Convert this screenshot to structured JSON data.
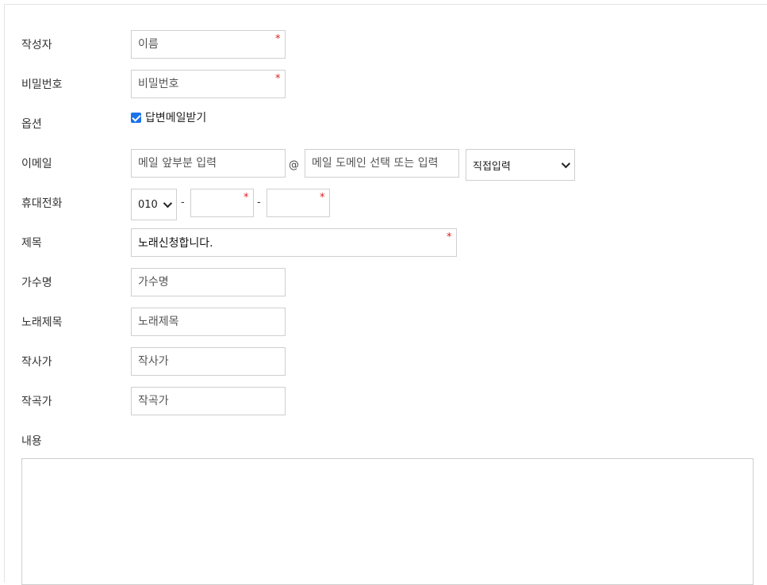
{
  "form": {
    "author": {
      "label": "작성자",
      "placeholder": "이름",
      "required_mark": "*"
    },
    "password": {
      "label": "비밀번호",
      "placeholder": "비밀번호",
      "required_mark": "*"
    },
    "options": {
      "label": "옵션",
      "reply_mail_label": "답변메일받기",
      "reply_mail_checked": true
    },
    "email": {
      "label": "이메일",
      "local_placeholder": "메일 앞부분 입력",
      "at_symbol": "@",
      "domain_placeholder": "메일 도메인 선택 또는 입력",
      "domain_select_value": "직접입력"
    },
    "phone": {
      "label": "휴대전화",
      "prefix_value": "010",
      "separator": "-",
      "required_mark": "*"
    },
    "subject": {
      "label": "제목",
      "value": "노래신청합니다.",
      "required_mark": "*"
    },
    "singer": {
      "label": "가수명",
      "placeholder": "가수명"
    },
    "song_title": {
      "label": "노래제목",
      "placeholder": "노래제목"
    },
    "lyricist": {
      "label": "작사가",
      "placeholder": "작사가"
    },
    "composer": {
      "label": "작곡가",
      "placeholder": "작곡가"
    },
    "content": {
      "label": "내용"
    }
  }
}
